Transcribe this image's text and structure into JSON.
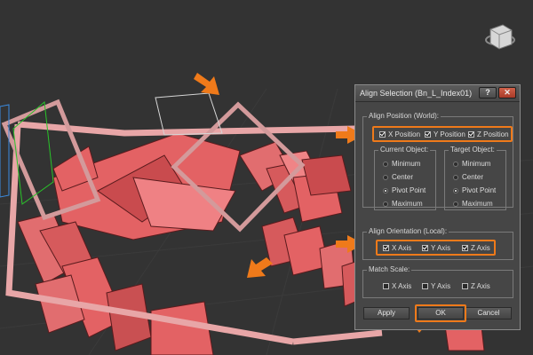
{
  "viewport": {
    "background_color": "#333333",
    "object_color": "#e4696b",
    "annotation_color": "#ef7a1a",
    "viewcube_icon": "viewcube-icon"
  },
  "dialog": {
    "title": "Align Selection (Bn_L_Index01)",
    "help_label": "?",
    "close_icon": "close-icon",
    "align_position": {
      "label": "Align Position (World):",
      "x_label": "X Position",
      "x_checked": true,
      "y_label": "Y Position",
      "y_checked": true,
      "z_label": "Z Position",
      "z_checked": true
    },
    "current_object": {
      "label": "Current Object:",
      "options": [
        "Minimum",
        "Center",
        "Pivot Point",
        "Maximum"
      ],
      "selected": "Pivot Point"
    },
    "target_object": {
      "label": "Target Object:",
      "options": [
        "Minimum",
        "Center",
        "Pivot Point",
        "Maximum"
      ],
      "selected": "Pivot Point"
    },
    "align_orientation": {
      "label": "Align Orientation (Local):",
      "x_label": "X Axis",
      "x_checked": true,
      "y_label": "Y Axis",
      "y_checked": true,
      "z_label": "Z Axis",
      "z_checked": true
    },
    "match_scale": {
      "label": "Match Scale:",
      "x_label": "X Axis",
      "x_checked": false,
      "y_label": "Y Axis",
      "y_checked": false,
      "z_label": "Z Axis",
      "z_checked": false
    },
    "buttons": {
      "apply": "Apply",
      "ok": "OK",
      "cancel": "Cancel"
    }
  }
}
